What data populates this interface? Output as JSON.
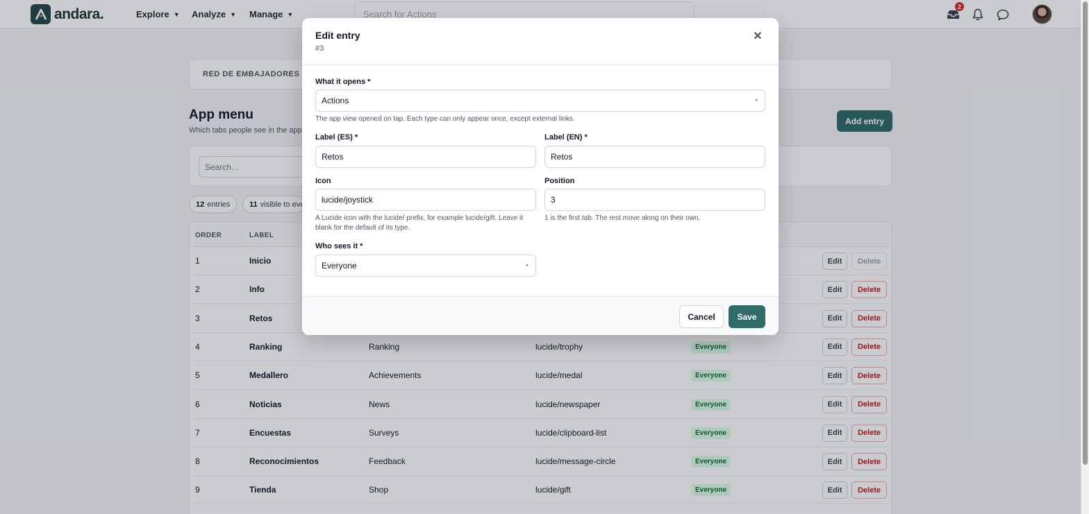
{
  "app": {
    "brand": "andara."
  },
  "nav": {
    "items": [
      {
        "label": "Explore"
      },
      {
        "label": "Analyze"
      },
      {
        "label": "Manage"
      }
    ],
    "search_placeholder": "Search for Actions",
    "inbox_badge": "2"
  },
  "page": {
    "org_name": "RED DE EMBAJADORES AND",
    "title": "App menu",
    "subtitle": "Which tabs people see in the app",
    "add_button": "Add entry",
    "search_placeholder": "Search...",
    "stats": {
      "entries_count": "12",
      "entries_label": "entries",
      "visible_count": "11",
      "visible_label": "visible to eve"
    }
  },
  "table": {
    "columns": [
      "ORDER",
      "LABEL"
    ],
    "edit_label": "Edit",
    "delete_label": "Delete",
    "rows": [
      {
        "order": "1",
        "label_es": "Inicio",
        "label_en": "",
        "icon": "",
        "visibility": ""
      },
      {
        "order": "2",
        "label_es": "Info",
        "label_en": "",
        "icon": "",
        "visibility": ""
      },
      {
        "order": "3",
        "label_es": "Retos",
        "label_en": "",
        "icon": "",
        "visibility": ""
      },
      {
        "order": "4",
        "label_es": "Ranking",
        "label_en": "Ranking",
        "icon": "lucide/trophy",
        "visibility": "Everyone"
      },
      {
        "order": "5",
        "label_es": "Medallero",
        "label_en": "Achievements",
        "icon": "lucide/medal",
        "visibility": "Everyone"
      },
      {
        "order": "6",
        "label_es": "Noticias",
        "label_en": "News",
        "icon": "lucide/newspaper",
        "visibility": "Everyone"
      },
      {
        "order": "7",
        "label_es": "Encuestas",
        "label_en": "Surveys",
        "icon": "lucide/clipboard-list",
        "visibility": "Everyone"
      },
      {
        "order": "8",
        "label_es": "Reconocimientos",
        "label_en": "Feedback",
        "icon": "lucide/message-circle",
        "visibility": "Everyone"
      },
      {
        "order": "9",
        "label_es": "Tienda",
        "label_en": "Shop",
        "icon": "lucide/gift",
        "visibility": "Everyone"
      }
    ]
  },
  "modal": {
    "title": "Edit entry",
    "subtitle": "#3",
    "what_opens": {
      "label": "What it opens *",
      "value": "Actions",
      "help": "The app view opened on tap. Each type can only appear once, except external links."
    },
    "label_es": {
      "label": "Label (ES) *",
      "value": "Retos"
    },
    "label_en": {
      "label": "Label (EN) *",
      "value": "Retos"
    },
    "icon": {
      "label": "Icon",
      "value": "lucide/joystick",
      "help": "A Lucide icon with the lucide/ prefix, for example lucide/gift. Leave it blank for the default of its type."
    },
    "position": {
      "label": "Position",
      "value": "3",
      "help": "1 is the first tab. The rest move along on their own."
    },
    "who_sees": {
      "label": "Who sees it *",
      "value": "Everyone"
    },
    "cancel": "Cancel",
    "save": "Save"
  }
}
